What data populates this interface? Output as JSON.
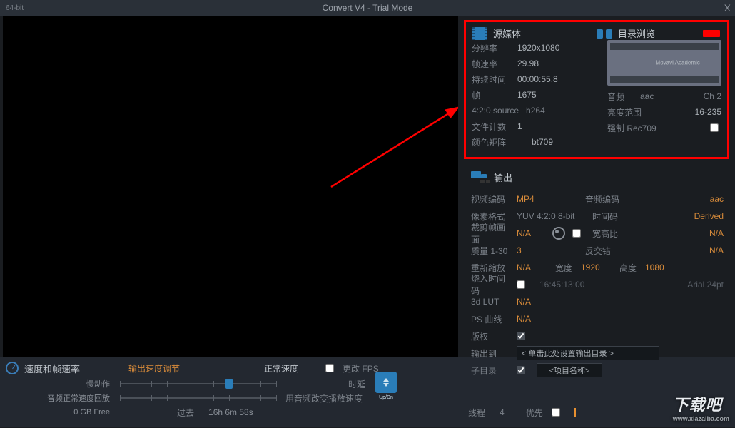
{
  "titlebar": {
    "arch": "64-bit",
    "title": "Convert V4 - Trial Mode",
    "min": "—",
    "close": "X"
  },
  "source": {
    "header": "源媒体",
    "browse": "目录浏览",
    "thumb_txt": "Movavi Academic",
    "res_lbl": "分辨率",
    "res": "1920x1080",
    "fps_lbl": "帧速率",
    "fps": "29.98",
    "dur_lbl": "持续时间",
    "dur": "00:00:55.8",
    "frames_lbl": "帧",
    "frames": "1675",
    "source_fmt": "4:2:0 source",
    "codec": "h264",
    "files_lbl": "文件计数",
    "files": "1",
    "matrix_lbl": "颜色矩阵",
    "matrix": "bt709",
    "audio_lbl": "音频",
    "audio": "aac",
    "ch": "Ch 2",
    "luma_lbl": "亮度范围",
    "luma": "16-235",
    "force_lbl": "强制 Rec709"
  },
  "output": {
    "header": "输出",
    "venc_lbl": "视频编码",
    "venc": "MP4",
    "aenc_lbl": "音频编码",
    "aenc": "aac",
    "pix_lbl": "像素格式",
    "pix": "YUV 4:2:0 8-bit",
    "tc_lbl": "时间码",
    "tc": "Derived",
    "crop_lbl": "裁剪帧画面",
    "crop": "N/A",
    "ar_lbl": "宽高比",
    "ar": "N/A",
    "q_lbl": "质量 1-30",
    "q": "3",
    "deint_lbl": "反交错",
    "deint": "N/A",
    "rescale_lbl": "重新缩放",
    "rescale": "N/A",
    "w_lbl": "宽度",
    "w": "1920",
    "h_lbl": "高度",
    "h": "1080",
    "burn_lbl": "烧入时间码",
    "burn_tc": "16:45:13:00",
    "burn_font": "Arial 24pt",
    "lut_lbl": "3d LUT",
    "lut": "N/A",
    "ps_lbl": "PS 曲线",
    "ps": "N/A",
    "copy_lbl": "版权",
    "out_lbl": "输出到",
    "out_path": "< 单击此处设置输出目录 >",
    "sub_lbl": "子目录",
    "sub_val": "<项目名称>"
  },
  "speed": {
    "header": "速度和帧速率",
    "adjust": "输出速度调节",
    "normal": "正常速度",
    "change_fps": "更改 FPS",
    "slow": "慢动作",
    "delay": "时延",
    "updn": "Up/Dn",
    "audio_normal": "音频正常速度回放",
    "audio_change": "用音频改变播放速度",
    "free": "0 GB Free",
    "past_lbl": "过去",
    "past": "16h 6m 58s"
  },
  "footer": {
    "threads_lbl": "线程",
    "threads": "4",
    "prio_lbl": "优先"
  },
  "watermark": {
    "main": "下载吧",
    "url": "www.xiazaiba.com"
  }
}
